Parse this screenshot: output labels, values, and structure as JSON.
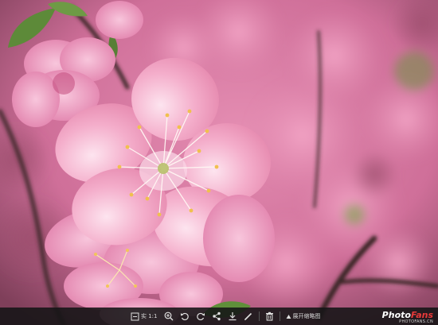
{
  "photo": {
    "subject": "pink-peach-blossom",
    "colors": {
      "petal": "#f0a6c4",
      "petal_dark": "#d85c8d",
      "background": "#d77aa3",
      "branch": "#3b2b2c",
      "leaf": "#5f8f3a"
    }
  },
  "toolbar": {
    "original_size_label": "实 1:1",
    "expand_label": "展开缩略图"
  },
  "watermark": {
    "brand_white": "Photo",
    "brand_red": "Fans",
    "url": "PHOTOFANS.CN"
  }
}
